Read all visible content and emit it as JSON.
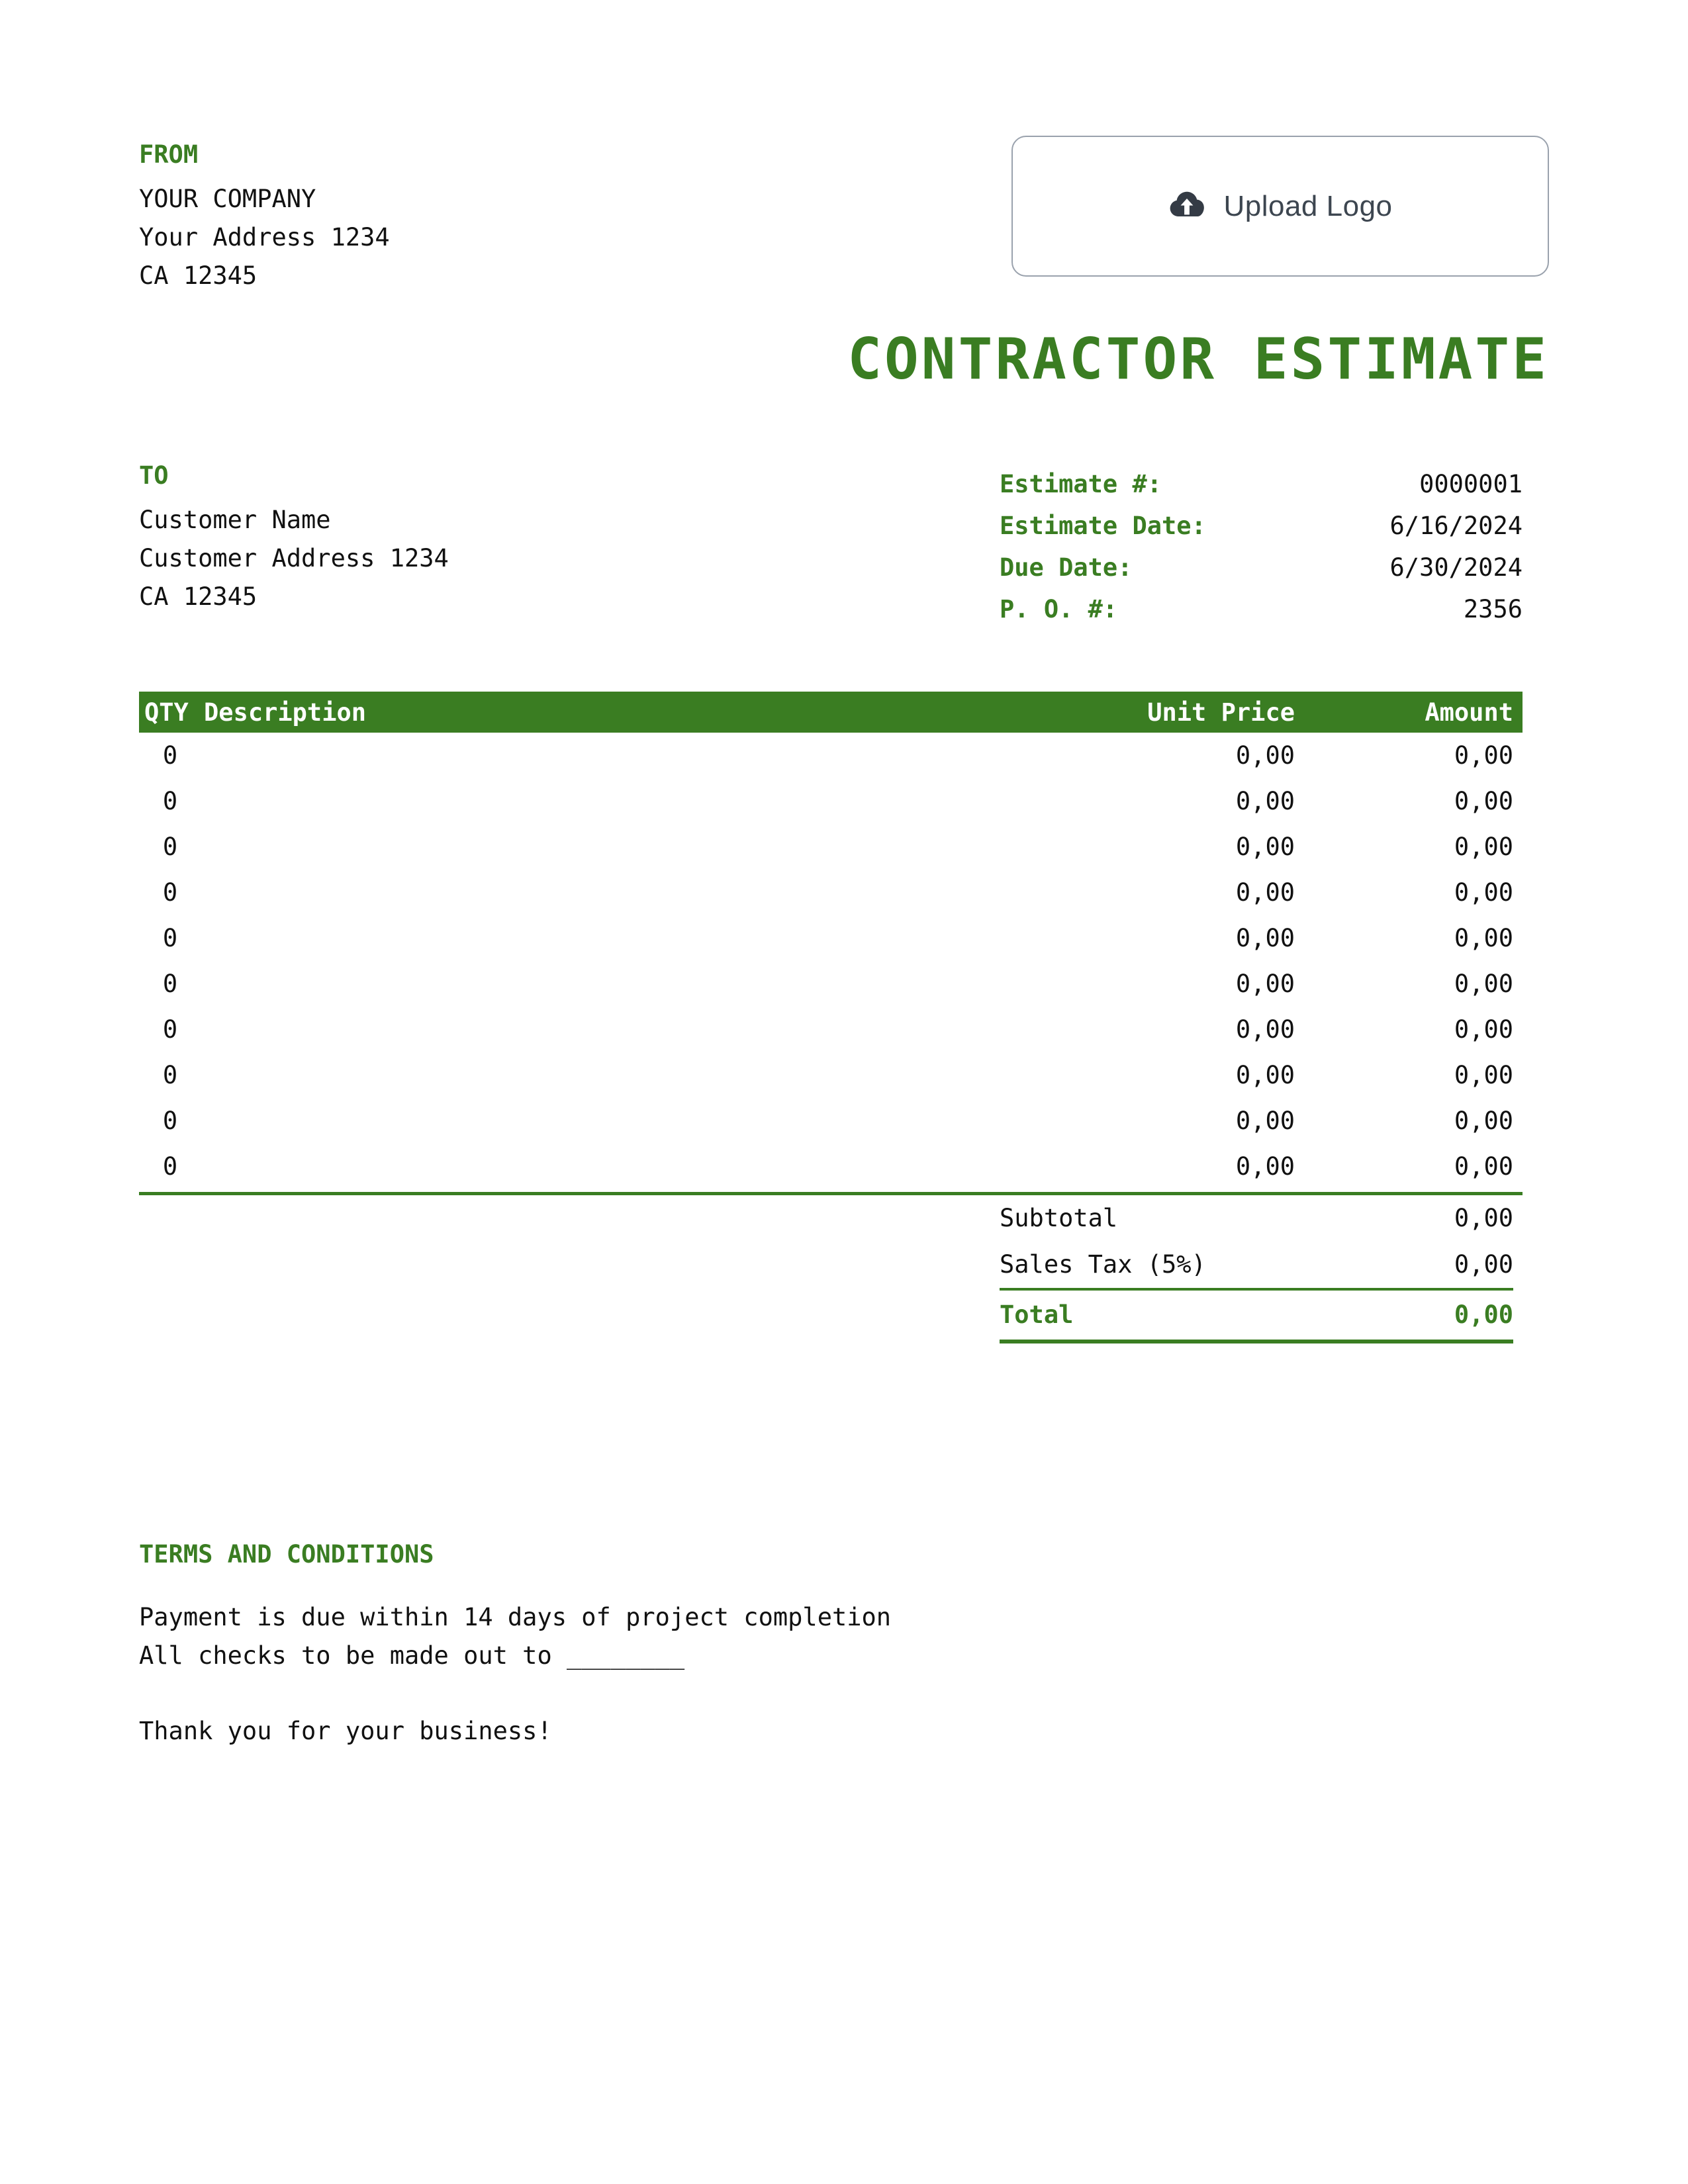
{
  "document": {
    "title": "CONTRACTOR ESTIMATE",
    "accent_color": "#3a7d22",
    "text_color": "#111111"
  },
  "from": {
    "label": "FROM",
    "lines": [
      "YOUR COMPANY",
      "Your Address 1234",
      "CA 12345"
    ]
  },
  "logo_upload": {
    "icon": "cloud-upload-icon",
    "label": "Upload Logo"
  },
  "to": {
    "label": "TO",
    "lines": [
      "Customer Name",
      "Customer Address 1234",
      "CA 12345"
    ]
  },
  "meta": {
    "rows": [
      {
        "label": "Estimate #:",
        "value": "0000001"
      },
      {
        "label": "Estimate Date:",
        "value": "6/16/2024"
      },
      {
        "label": "Due Date:",
        "value": "6/30/2024"
      },
      {
        "label": "P. O. #:",
        "value": "2356"
      }
    ]
  },
  "items_table": {
    "headers": {
      "qty": "QTY",
      "description": "Description",
      "unit_price": "Unit Price",
      "amount": "Amount"
    },
    "rows": [
      {
        "qty": "0",
        "description": "",
        "unit_price": "0,00",
        "amount": "0,00"
      },
      {
        "qty": "0",
        "description": "",
        "unit_price": "0,00",
        "amount": "0,00"
      },
      {
        "qty": "0",
        "description": "",
        "unit_price": "0,00",
        "amount": "0,00"
      },
      {
        "qty": "0",
        "description": "",
        "unit_price": "0,00",
        "amount": "0,00"
      },
      {
        "qty": "0",
        "description": "",
        "unit_price": "0,00",
        "amount": "0,00"
      },
      {
        "qty": "0",
        "description": "",
        "unit_price": "0,00",
        "amount": "0,00"
      },
      {
        "qty": "0",
        "description": "",
        "unit_price": "0,00",
        "amount": "0,00"
      },
      {
        "qty": "0",
        "description": "",
        "unit_price": "0,00",
        "amount": "0,00"
      },
      {
        "qty": "0",
        "description": "",
        "unit_price": "0,00",
        "amount": "0,00"
      },
      {
        "qty": "0",
        "description": "",
        "unit_price": "0,00",
        "amount": "0,00"
      }
    ]
  },
  "totals": {
    "subtotal_label": "Subtotal",
    "subtotal_value": "0,00",
    "tax_label": "Sales Tax (5%)",
    "tax_value": "0,00",
    "total_label": "Total",
    "total_value": "0,00"
  },
  "terms": {
    "title": "TERMS AND CONDITIONS",
    "line1": "Payment is due within 14 days of project completion",
    "line2": "All checks to be made out to ________",
    "thanks": "Thank you for your business!"
  }
}
